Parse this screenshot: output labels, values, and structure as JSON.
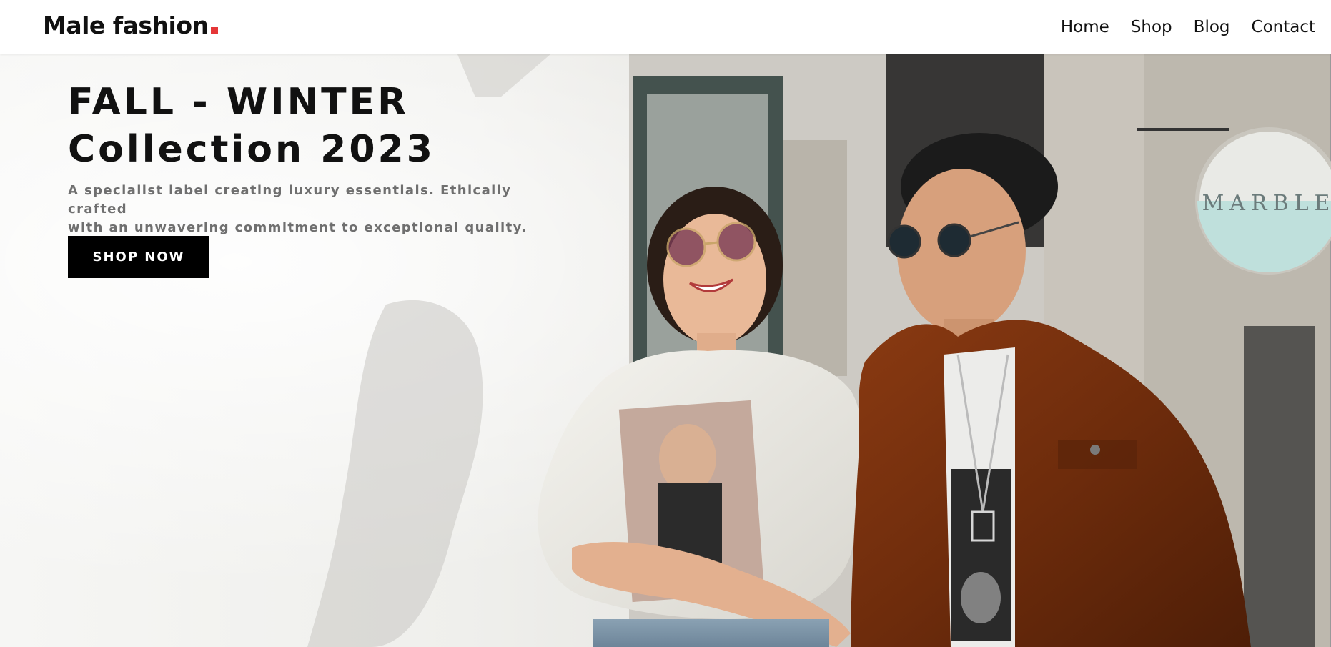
{
  "header": {
    "logo": {
      "text": "Male fashion",
      "dot_color": "#e53637"
    },
    "nav": [
      {
        "label": "Home"
      },
      {
        "label": "Shop"
      },
      {
        "label": "Blog"
      },
      {
        "label": "Contact"
      }
    ]
  },
  "hero": {
    "title_line1": "FALL - WINTER",
    "title_line2": "Collection 2023",
    "description_line1": "A specialist label creating luxury essentials. Ethically crafted",
    "description_line2": "with an unwavering commitment to exceptional quality.",
    "cta_label": "SHOP NOW",
    "image_content": "fashion-photo-couple",
    "sign_text": "MARBLE",
    "colors": {
      "accent": "#e53637",
      "button_bg": "#000000",
      "text_dark": "#111111",
      "text_muted": "#6f6f6f"
    }
  }
}
